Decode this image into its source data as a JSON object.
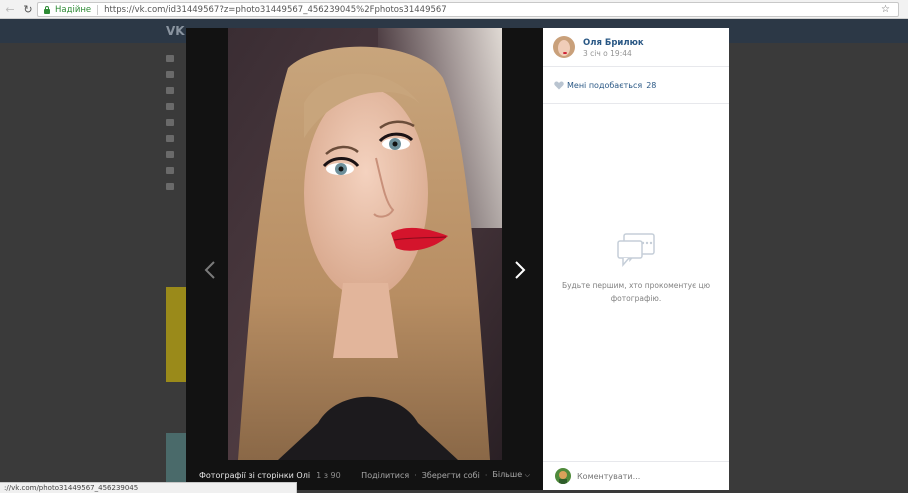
{
  "browser": {
    "secure_label": "Надійне",
    "url": "https://vk.com/id31449567?z=photo31449567_456239045%2Fphotos31449567",
    "status_url": "://vk.com/photo31449567_456239045"
  },
  "viewer": {
    "album_title": "Фотографії зі сторінки Олі",
    "counter": "1 з 90",
    "share_label": "Поділитися",
    "save_label": "Зберегти собі",
    "more_label": "Більше"
  },
  "panel": {
    "author_name": "Оля Брилюк",
    "post_date": "3 січ о 19:44",
    "like_label": "Мені подобається",
    "like_count": "28",
    "empty_text": "Будьте першим, хто прокоментує цю фотографію.",
    "comment_placeholder": "Коментувати..."
  },
  "colors": {
    "link": "#2a5885",
    "secure": "#2e8b35",
    "viewer_bg": "#121212"
  }
}
